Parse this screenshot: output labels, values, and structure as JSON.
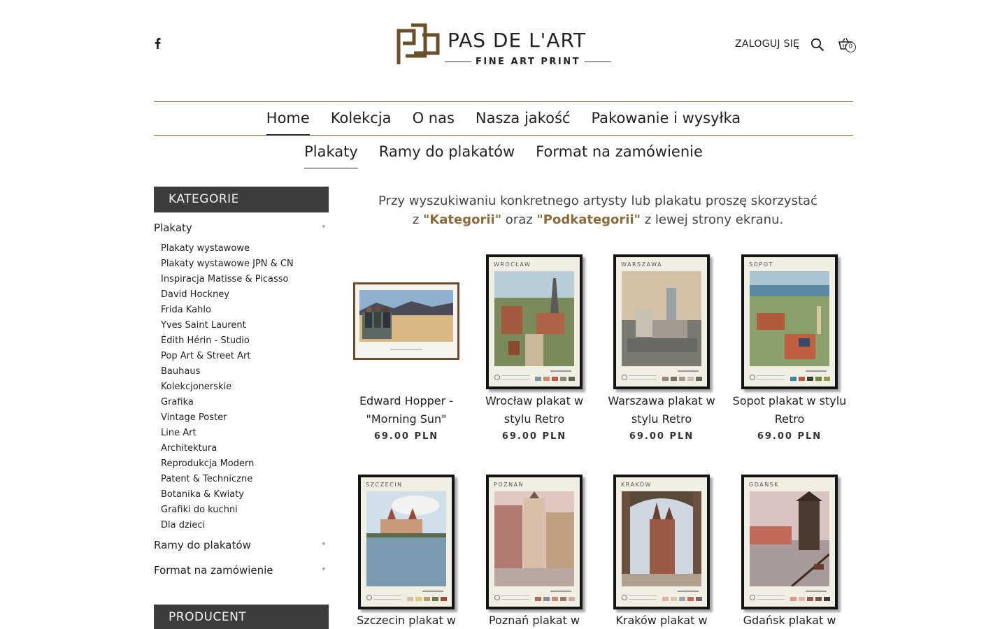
{
  "header": {
    "brand": "PAS DE L'ART",
    "tagline": "FINE ART PRINT",
    "login_label": "ZALOGUJ SIĘ",
    "cart_count": "0"
  },
  "main_nav": [
    {
      "label": "Home",
      "active": true
    },
    {
      "label": "Kolekcja",
      "active": false
    },
    {
      "label": "O nas",
      "active": false
    },
    {
      "label": "Nasza jakość",
      "active": false
    },
    {
      "label": "Pakowanie i wysyłka",
      "active": false
    }
  ],
  "sub_nav": [
    {
      "label": "Plakaty",
      "active": true
    },
    {
      "label": "Ramy do plakatów",
      "active": false
    },
    {
      "label": "Format na zamówienie",
      "active": false
    }
  ],
  "sidebar": {
    "categories_title": "KATEGORIE",
    "producer_title": "PRODUCENT",
    "main_categories": [
      "Plakaty",
      "Ramy do plakatów",
      "Format na zamówienie"
    ],
    "subcategories": [
      "Plakaty wystawowe",
      "Plakaty wystawowe JPN & CN",
      "Inspiracja Matisse & Picasso",
      "David Hockney",
      "Frida Kahlo",
      "Yves Saint Laurent",
      "Édith Hérin - Studio",
      "Pop Art & Street Art",
      "Bauhaus",
      "Kolekcjonerskie",
      "Grafika",
      "Vintage Poster",
      "Line Art",
      "Architektura",
      "Reprodukcja Modern",
      "Patent & Techniczne",
      "Botanika & Kwiaty",
      "Grafiki do kuchni",
      "Dla dzieci"
    ]
  },
  "info": {
    "line1": "Przy wyszukiwaniu konkretnego artysty lub plakatu proszę skorzystać",
    "prefix": "z ",
    "kategorii": "\"Kategorii\"",
    "oraz": " oraz ",
    "podkategorii": "\"Podkategorii\"",
    "suffix": " z lewej strony ekranu."
  },
  "products": [
    {
      "name": "Edward Hopper - \"Morning Sun\"",
      "price": "69.00 PLN"
    },
    {
      "name": "Wrocław plakat w stylu Retro",
      "price": "69.00 PLN",
      "city": "WROCŁAW"
    },
    {
      "name": "Warszawa plakat w stylu Retro",
      "price": "69.00 PLN",
      "city": "WARSZAWA"
    },
    {
      "name": "Sopot plakat w stylu Retro",
      "price": "69.00 PLN",
      "city": "SOPOT"
    },
    {
      "name": "Szczecin plakat w",
      "city": "SZCZECIN"
    },
    {
      "name": "Poznań plakat w",
      "city": "POZNAŃ"
    },
    {
      "name": "Kraków plakat w",
      "city": "KRAKÓW"
    },
    {
      "name": "Gdańsk plakat w",
      "city": "GDAŃSK"
    }
  ],
  "colors": {
    "accent": "#8a6d3b",
    "sidebar_header": "#3c3c3c"
  },
  "icons": [
    "facebook-icon",
    "search-icon",
    "cart-icon",
    "chevron-down-icon"
  ]
}
